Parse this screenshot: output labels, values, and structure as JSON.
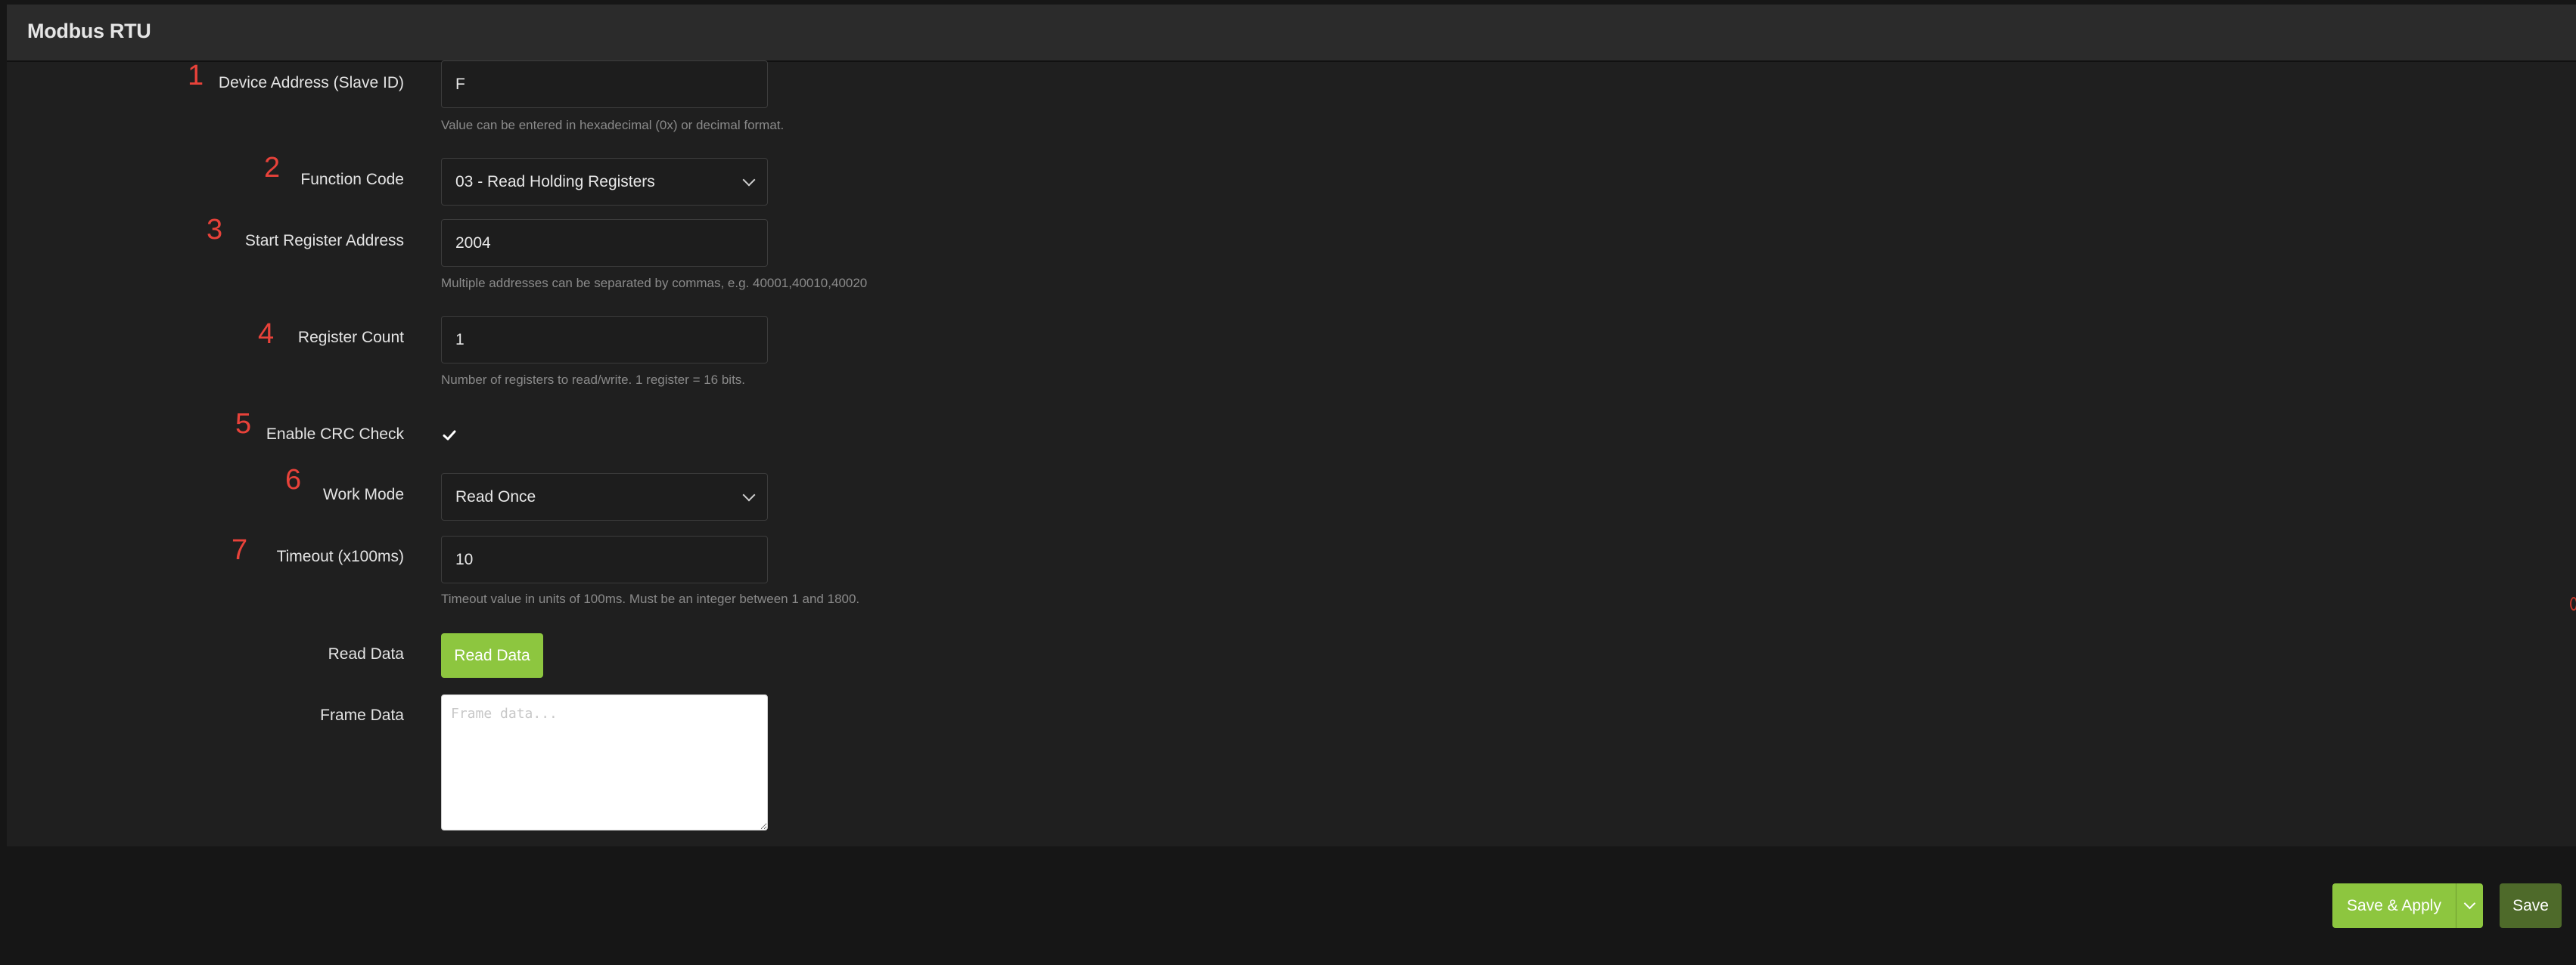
{
  "panel": {
    "title": "Modbus RTU"
  },
  "fields": {
    "device_address": {
      "marker": "1",
      "label": "Device Address (Slave ID)",
      "value": "F",
      "hint": "Value can be entered in hexadecimal (0x) or decimal format."
    },
    "function_code": {
      "marker": "2",
      "label": "Function Code",
      "value": "03 - Read Holding Registers"
    },
    "start_register": {
      "marker": "3",
      "label": "Start Register Address",
      "value": "2004",
      "hint": "Multiple addresses can be separated by commas, e.g. 40001,40010,40020"
    },
    "register_count": {
      "marker": "4",
      "label": "Register Count",
      "value": "1",
      "hint": "Number of registers to read/write. 1 register = 16 bits."
    },
    "crc_check": {
      "marker": "5",
      "label": "Enable CRC Check",
      "checked": true
    },
    "work_mode": {
      "marker": "6",
      "label": "Work Mode",
      "value": "Read Once"
    },
    "timeout": {
      "marker": "7",
      "label": "Timeout (x100ms)",
      "value": "10",
      "hint": "Timeout value in units of 100ms. Must be an integer between 1 and 1800."
    },
    "read_data": {
      "label": "Read Data",
      "button": "Read Data"
    },
    "frame_data": {
      "label": "Frame Data",
      "placeholder": "Frame data..."
    }
  },
  "footer": {
    "save_apply": "Save & Apply",
    "save": "Save"
  },
  "colors": {
    "accent": "#8dc63f",
    "save_dark": "#4e6a2a",
    "marker": "#e8423a",
    "background": "#1f1f1f"
  }
}
